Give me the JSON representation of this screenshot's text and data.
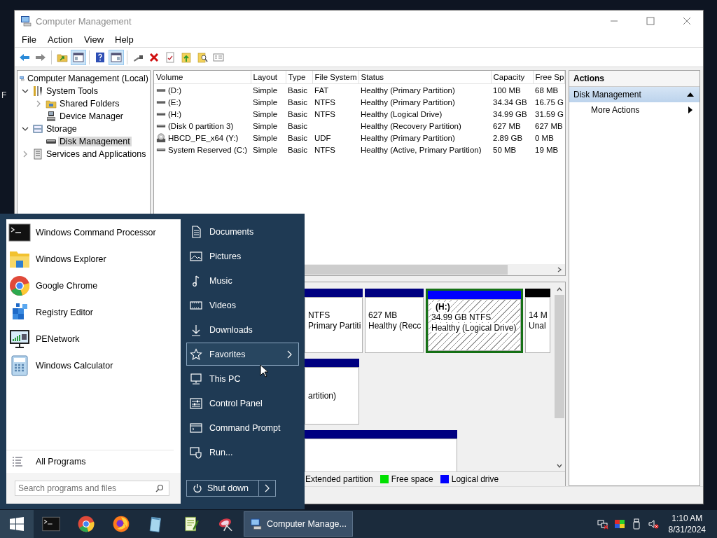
{
  "desktop": {
    "labels": [
      "F"
    ]
  },
  "window": {
    "title": "Computer Management",
    "menu": [
      "File",
      "Action",
      "View",
      "Help"
    ],
    "toolbar": [
      {
        "kind": "back",
        "pressed": false
      },
      {
        "kind": "forward",
        "pressed": false
      },
      {
        "kind": "separator"
      },
      {
        "kind": "up",
        "pressed": false
      },
      {
        "kind": "console",
        "pressed": true
      },
      {
        "kind": "separator"
      },
      {
        "kind": "help",
        "pressed": false
      },
      {
        "kind": "actionpane",
        "pressed": true
      },
      {
        "kind": "separator"
      },
      {
        "kind": "connect",
        "pressed": false
      },
      {
        "kind": "delete",
        "pressed": false
      },
      {
        "kind": "properties",
        "pressed": false
      },
      {
        "kind": "export",
        "pressed": false
      },
      {
        "kind": "find",
        "pressed": false
      },
      {
        "kind": "list",
        "pressed": false
      }
    ]
  },
  "tree": [
    {
      "label": "Computer Management (Local)",
      "kind": "computer",
      "selected": false,
      "children": [
        {
          "label": "System Tools",
          "kind": "tools",
          "expanded": true,
          "selected": false,
          "children": [
            {
              "label": "Shared Folders",
              "kind": "share",
              "expanded": false,
              "selected": false
            },
            {
              "label": "Device Manager",
              "kind": "device",
              "selected": false
            }
          ]
        },
        {
          "label": "Storage",
          "kind": "storage",
          "expanded": true,
          "selected": false,
          "children": [
            {
              "label": "Disk Management",
              "kind": "disk",
              "selected": true
            }
          ]
        },
        {
          "label": "Services and Applications",
          "kind": "services",
          "expanded": false,
          "selected": false
        }
      ]
    }
  ],
  "table": {
    "columns": [
      "Volume",
      "Layout",
      "Type",
      "File System",
      "Status",
      "Capacity",
      "Free Sp"
    ],
    "rows": [
      {
        "kind": "drive",
        "cells": [
          "(D:)",
          "Simple",
          "Basic",
          "FAT",
          "Healthy (Primary Partition)",
          "100 MB",
          "68 MB"
        ]
      },
      {
        "kind": "drive",
        "cells": [
          "(E:)",
          "Simple",
          "Basic",
          "NTFS",
          "Healthy (Primary Partition)",
          "34.34 GB",
          "16.75 G"
        ]
      },
      {
        "kind": "drive",
        "cells": [
          "(H:)",
          "Simple",
          "Basic",
          "NTFS",
          "Healthy (Logical Drive)",
          "34.99 GB",
          "31.59 G"
        ]
      },
      {
        "kind": "drive",
        "cells": [
          "(Disk 0 partition 3)",
          "Simple",
          "Basic",
          "",
          "Healthy (Recovery Partition)",
          "627 MB",
          "627 MB"
        ]
      },
      {
        "kind": "cd",
        "cells": [
          "HBCD_PE_x64 (Y:)",
          "Simple",
          "Basic",
          "UDF",
          "Healthy (Primary Partition)",
          "2.89 GB",
          "0 MB"
        ]
      },
      {
        "kind": "drive",
        "cells": [
          "System Reserved (C:)",
          "Simple",
          "Basic",
          "NTFS",
          "Healthy (Active, Primary Partition)",
          "50 MB",
          "19 MB"
        ]
      }
    ]
  },
  "disk_map": {
    "rows": [
      {
        "partitions": [
          {
            "color": "#000080",
            "size": "NTFS",
            "status": "Primary Partiti",
            "selected": false
          },
          {
            "color": "#000080",
            "size": "627 MB",
            "status": "Healthy (Recc",
            "selected": false
          },
          {
            "color": "#0000ff",
            "name": "(H:)",
            "size": "34.99 GB NTFS",
            "status": "Healthy (Logical Drive)",
            "selected": true
          },
          {
            "color": "#000000",
            "size": "14 M",
            "status": "Unal",
            "selected": false
          }
        ]
      },
      {
        "partitions": [
          {
            "color": "#000080",
            "status": "artition)",
            "selected": false
          }
        ]
      },
      {
        "partitions": [
          {
            "color": "#000080",
            "selected": false
          }
        ]
      }
    ],
    "legend": [
      {
        "label": "Extended partition"
      },
      {
        "label": "Free space",
        "color": "#00e000"
      },
      {
        "label": "Logical drive",
        "color": "#0000ff"
      }
    ]
  },
  "actions": {
    "header": "Actions",
    "groups": [
      {
        "title": "Disk Management",
        "expanded": true,
        "items": [
          "More Actions"
        ]
      }
    ]
  },
  "start_menu": {
    "programs": [
      {
        "label": "Windows Command Processor",
        "kind": "cmd"
      },
      {
        "label": "Windows Explorer",
        "kind": "explorer"
      },
      {
        "label": "Google Chrome",
        "kind": "chrome"
      },
      {
        "label": "Registry Editor",
        "kind": "regedit"
      },
      {
        "label": "PENetwork",
        "kind": "network"
      },
      {
        "label": "Windows Calculator",
        "kind": "calc"
      }
    ],
    "all_programs": "All Programs",
    "search": {
      "placeholder": "Search programs and files"
    },
    "places": [
      {
        "label": "Documents",
        "kind": "documents",
        "selected": false
      },
      {
        "label": "Pictures",
        "kind": "pictures",
        "selected": false
      },
      {
        "label": "Music",
        "kind": "music",
        "selected": false
      },
      {
        "label": "Videos",
        "kind": "videos",
        "selected": false
      },
      {
        "label": "Downloads",
        "kind": "downloads",
        "selected": false
      },
      {
        "label": "Favorites",
        "kind": "favorites",
        "selected": true,
        "submenu": true
      },
      {
        "label": "This PC",
        "kind": "pc",
        "selected": false
      },
      {
        "label": "Control Panel",
        "kind": "control",
        "selected": false
      },
      {
        "label": "Command Prompt",
        "kind": "cmdprompt",
        "selected": false
      },
      {
        "label": "Run...",
        "kind": "run",
        "selected": false
      }
    ],
    "shutdown": "Shut down"
  },
  "taskbar": {
    "apps": [
      {
        "kind": "cmd"
      },
      {
        "kind": "chrome"
      },
      {
        "kind": "firefox"
      },
      {
        "kind": "notepad"
      },
      {
        "kind": "notepadpp"
      },
      {
        "kind": "snip"
      }
    ],
    "windows": [
      {
        "title": "Computer Manage...",
        "selected": true
      }
    ],
    "tray": [
      {
        "kind": "network"
      },
      {
        "kind": "color"
      },
      {
        "kind": "usb"
      },
      {
        "kind": "volume"
      }
    ],
    "time": "1:10 AM",
    "date": "8/31/2024"
  }
}
